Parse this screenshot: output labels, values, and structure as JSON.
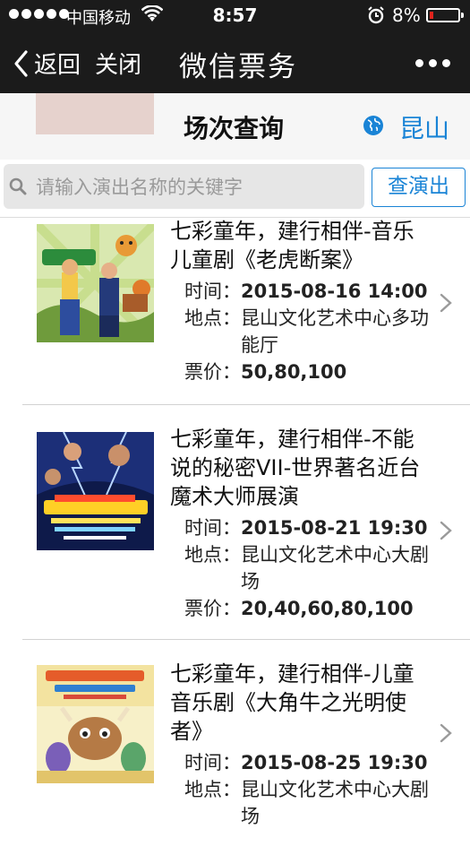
{
  "status": {
    "carrier": "中国移动",
    "time": "8:57",
    "battery": "8%"
  },
  "nav": {
    "back_label": "返回",
    "close_label": "关闭",
    "title": "微信票务"
  },
  "header": {
    "title": "场次查询",
    "city": "昆山"
  },
  "search": {
    "placeholder": "请输入演出名称的关键字",
    "button_label": "查演出"
  },
  "labels": {
    "time": "时间：",
    "venue": "地点：",
    "price": "票价："
  },
  "shows": [
    {
      "name": "七彩童年，建行相伴-音乐儿童剧《老虎断案》",
      "time": "2015-08-16 14:00",
      "venue": "昆山文化艺术中心多功能厅",
      "price": "50,80,100"
    },
    {
      "name": "七彩童年，建行相伴-不能说的秘密VII-世界著名近台魔术大师展演",
      "time": "2015-08-21 19:30",
      "venue": "昆山文化艺术中心大剧场",
      "price": "20,40,60,80,100"
    },
    {
      "name": "七彩童年，建行相伴-儿童音乐剧《大角牛之光明使者》",
      "time": "2015-08-25 19:30",
      "venue": "昆山文化艺术中心大剧场",
      "price": ""
    }
  ]
}
